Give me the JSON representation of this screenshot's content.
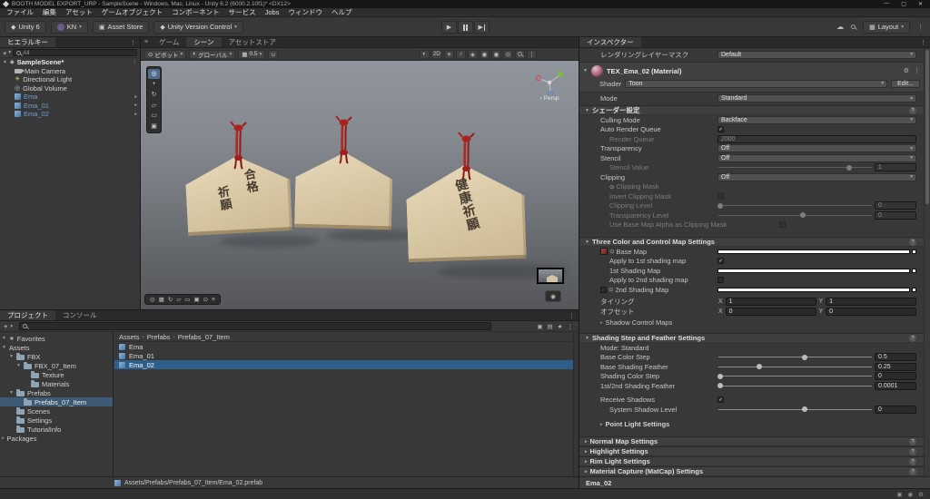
{
  "window": {
    "title": "BOOTH MODEL EXPORT_URP - SampleScene - Windows, Mac, Linux - Unity 6.2 (6000.2.10f1)* <DX12>"
  },
  "menu": {
    "items": [
      "ファイル",
      "編集",
      "アセット",
      "ゲームオブジェクト",
      "コンポーネント",
      "サービス",
      "Jobs",
      "ウィンドウ",
      "ヘルプ"
    ]
  },
  "toolbar": {
    "unity_version": "Unity 6",
    "account": "KN",
    "asset_store": "Asset Store",
    "version_control": "Unity Version Control",
    "layout": "Layout"
  },
  "hierarchy": {
    "tab": "ヒエラルキー",
    "search_value": "All",
    "scene_name": "SampleScene*",
    "items": [
      {
        "label": "Main Camera"
      },
      {
        "label": "Directional Light"
      },
      {
        "label": "Global Volume"
      },
      {
        "label": "Ema"
      },
      {
        "label": "Ema_01"
      },
      {
        "label": "Ema_02"
      }
    ]
  },
  "scene": {
    "tabs": {
      "game": "ゲーム",
      "scene": "シーン",
      "asset_store": "アセットストア"
    },
    "toolbar": {
      "pivot": "ピボット",
      "orientation": "グローバル",
      "grid_size": "0.5",
      "two_d": "2D"
    },
    "gizmo": {
      "label": "Persp"
    },
    "plaques": [
      {
        "cols": [
          "合格",
          "祈願"
        ]
      },
      {
        "cols": []
      },
      {
        "cols": [
          "健康祈願"
        ]
      }
    ]
  },
  "project": {
    "tabs": {
      "project": "プロジェクト",
      "console": "コンソール"
    },
    "tree": [
      {
        "label": "Favorites"
      },
      {
        "label": "Assets"
      },
      {
        "label": "FBX"
      },
      {
        "label": "FBX_07_Item"
      },
      {
        "label": "Texture"
      },
      {
        "label": "Materials"
      },
      {
        "label": "Prefabs"
      },
      {
        "label": "Prefabs_07_Item"
      },
      {
        "label": "Scenes"
      },
      {
        "label": "Settings"
      },
      {
        "label": "TutorialInfo"
      },
      {
        "label": "Packages"
      }
    ],
    "breadcrumb": {
      "root": "Assets",
      "mid": "Prefabs",
      "leaf": "Prefabs_07_Item"
    },
    "files": [
      {
        "label": "Ema"
      },
      {
        "label": "Ema_01"
      },
      {
        "label": "Ema_02"
      }
    ],
    "status_path": "Assets/Prefabs/Prefabs_07_Item/Ema_02.prefab"
  },
  "inspector": {
    "tab": "インスペクター",
    "rendering_layer_mask": {
      "label": "レンダリングレイヤーマスク",
      "value": "Default"
    },
    "material": {
      "title": "TEX_Ema_02 (Material)",
      "shader_label": "Shader",
      "shader_value": "Toon",
      "edit_button": "Edit..."
    },
    "mode": {
      "label": "Mode",
      "value": "Standard"
    },
    "shader_settings": {
      "title": "シェーダー設定",
      "culling": {
        "label": "Culling Mode",
        "value": "Backface"
      },
      "auto_render_queue": {
        "label": "Auto Render Queue",
        "mark": "✓"
      },
      "render_queue": {
        "label": "Render Queue",
        "value": "2000"
      },
      "transparency": {
        "label": "Transparency",
        "value": "Off"
      },
      "stencil": {
        "label": "Stencil",
        "value": "Off"
      },
      "stencil_value": {
        "label": "Stencil Value",
        "value": "1",
        "pct": 85
      },
      "clipping": {
        "label": "Clipping",
        "value": "Off"
      },
      "clipping_mask": {
        "label": "Clipping Mask"
      },
      "invert_clipping_mask": {
        "label": "Invert Clipping Mask",
        "mark": ""
      },
      "clipping_level": {
        "label": "Clipping Level",
        "value": "0",
        "pct": 2
      },
      "transparency_level": {
        "label": "Transparency Level",
        "value": "0",
        "pct": 55
      },
      "use_base_map_alpha": {
        "label": "Use Base Map Alpha as Clipping Mask",
        "mark": ""
      }
    },
    "three_color": {
      "title": "Three Color and Control Map Settings",
      "base_map": {
        "label": "Base Map"
      },
      "apply_1st": {
        "label": "Apply to 1st shading map",
        "mark": "✓"
      },
      "first_shading_map": {
        "label": "1st Shading Map"
      },
      "apply_2nd": {
        "label": "Apply to 2nd shading map",
        "mark": ""
      },
      "second_shading_map": {
        "label": "2nd Shading Map",
        "mark": ""
      },
      "tiling": {
        "label": "タイリング",
        "x_label": "X",
        "x": "1",
        "y_label": "Y",
        "y": "1"
      },
      "offset": {
        "label": "オフセット",
        "x_label": "X",
        "x": "0",
        "y_label": "Y",
        "y": "0"
      },
      "shadow_control_maps": {
        "label": "Shadow Control Maps"
      }
    },
    "shading_step": {
      "title": "Shading Step and Feather Settings",
      "mode_label": "Mode: Standard",
      "base_color_step": {
        "label": "Base Color Step",
        "value": "0.5",
        "pct": 56
      },
      "base_shading_feather": {
        "label": "Base Shading Feather",
        "value": "0.25",
        "pct": 27
      },
      "shading_color_step": {
        "label": "Shading Color Step",
        "value": "0",
        "pct": 2
      },
      "shading_feather_12": {
        "label": "1st/2nd Shading Feather",
        "value": "0.0001",
        "pct": 2
      },
      "receive_shadows": {
        "label": "Receive Shadows",
        "mark": "✓"
      },
      "system_shadow_level": {
        "label": "System Shadow Level",
        "value": "0",
        "pct": 56
      },
      "point_light": {
        "label": "Point Light Settings"
      }
    },
    "collapsed_sections": [
      {
        "label": "Normal Map Settings"
      },
      {
        "label": "Highlight Settings"
      },
      {
        "label": "Rim Light Settings"
      },
      {
        "label": "Material Capture (MatCap) Settings"
      }
    ],
    "preview_title": "Ema_02"
  },
  "icons": {
    "minimize": "—",
    "maximize": "▢",
    "close": "✕",
    "menu": "≡",
    "more": "⋮",
    "caret_down": "▾",
    "fold_open": "▼",
    "fold_closed": "▸",
    "plus": "+",
    "question": "?",
    "star": "★",
    "cloud": "☁",
    "play": "▶",
    "back": "‹",
    "crumb_sep": "›",
    "target": "⊙",
    "gear": "⚙",
    "grid": "▦",
    "pivot": "⊙",
    "orientation": "◐",
    "shaded": "◐",
    "light": "☀",
    "audio": "♪",
    "effects": "◈",
    "visibility": "◉",
    "camera": "◉",
    "rotate": "↻",
    "rect": "▭",
    "scale": "▱",
    "view": "◎",
    "snap": "∪",
    "diamond": "◆",
    "volume": "◎",
    "component": "▣",
    "label_filter": "▤"
  }
}
